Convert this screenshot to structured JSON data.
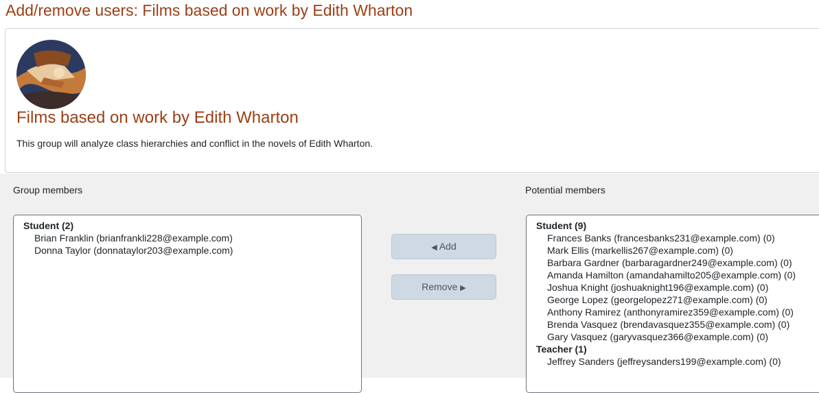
{
  "page": {
    "title": "Add/remove users: Films based on work by Edith Wharton"
  },
  "group": {
    "name": "Films based on work by Edith Wharton",
    "description": "This group will analyze class hierarchies and conflict in the novels of Edith Wharton.",
    "avatar_colors": [
      "#2b3a5e",
      "#c47a3a",
      "#e8c9a0"
    ]
  },
  "group_members": {
    "label": "Group members",
    "groups": [
      {
        "label": "Student (2)",
        "options": [
          "Brian Franklin (brianfrankli228@example.com)",
          "Donna Taylor (donnataylor203@example.com)"
        ]
      }
    ]
  },
  "actions": {
    "add_arrow": "◀",
    "add_label": "Add",
    "remove_label": "Remove",
    "remove_arrow": "▶"
  },
  "potential_members": {
    "label": "Potential members",
    "groups": [
      {
        "label": "Student (9)",
        "options": [
          "Frances Banks (francesbanks231@example.com) (0)",
          "Mark Ellis (markellis267@example.com) (0)",
          "Barbara Gardner (barbaragardner249@example.com) (0)",
          "Amanda Hamilton (amandahamilto205@example.com) (0)",
          "Joshua Knight (joshuaknight196@example.com) (0)",
          "George Lopez (georgelopez271@example.com) (0)",
          "Anthony Ramirez (anthonyramirez359@example.com) (0)",
          "Brenda Vasquez (brendavasquez355@example.com) (0)",
          "Gary Vasquez (garyvasquez366@example.com) (0)"
        ]
      },
      {
        "label": "Teacher (1)",
        "options": [
          "Jeffrey Sanders (jeffreysanders199@example.com) (0)"
        ]
      }
    ]
  }
}
